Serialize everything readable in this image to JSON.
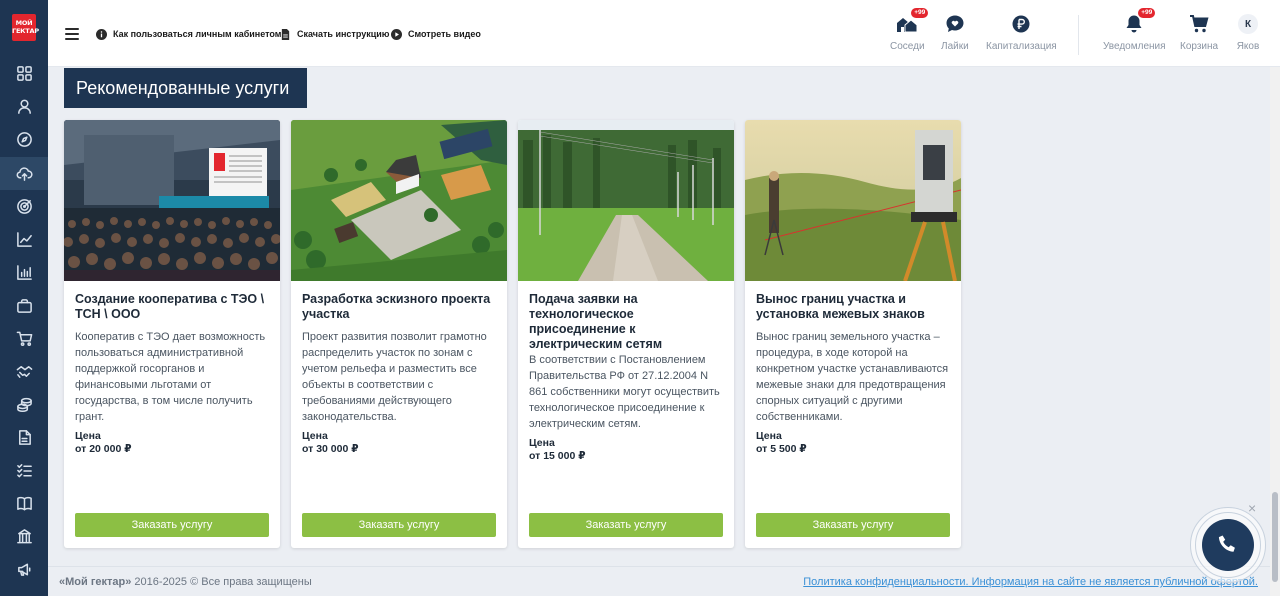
{
  "brand": {
    "logo_line1": "МОЙ",
    "logo_line2": "ГЕКТАР",
    "accent": "#e3262e",
    "sidebar_bg": "#1e3552",
    "button_color": "#8cbf44"
  },
  "sidebar": {
    "items": [
      {
        "icon": "grid-icon"
      },
      {
        "icon": "user-icon"
      },
      {
        "icon": "compass-icon"
      },
      {
        "icon": "cloud-upload-icon",
        "active": true
      },
      {
        "icon": "target-icon"
      },
      {
        "icon": "chart-line-icon"
      },
      {
        "icon": "bar-chart-icon"
      },
      {
        "icon": "briefcase-icon"
      },
      {
        "icon": "cart-icon"
      },
      {
        "icon": "handshake-icon"
      },
      {
        "icon": "coins-icon"
      },
      {
        "icon": "document-icon"
      },
      {
        "icon": "checklist-icon"
      },
      {
        "icon": "book-icon"
      },
      {
        "icon": "building-icon"
      },
      {
        "icon": "megaphone-icon"
      }
    ]
  },
  "header": {
    "links": [
      {
        "label": "Как пользоваться личным кабинетом?",
        "icon": "info-icon"
      },
      {
        "label": "Скачать инструкцию",
        "icon": "file-icon"
      },
      {
        "label": "Смотреть видео",
        "icon": "play-icon"
      }
    ],
    "actions": [
      {
        "label": "Соседи",
        "icon": "neighbors-icon",
        "badge": "+99"
      },
      {
        "label": "Лайки",
        "icon": "like-icon"
      },
      {
        "label": "Капитализация",
        "icon": "ruble-icon"
      },
      {
        "label": "Уведомления",
        "icon": "bell-icon",
        "badge": "+99"
      },
      {
        "label": "Корзина",
        "icon": "cart-icon"
      },
      {
        "label": "Яков",
        "icon": "avatar",
        "initial": "К"
      }
    ]
  },
  "main": {
    "section_title": "Рекомендованные услуги",
    "price_label": "Цена",
    "order_label": "Заказать услугу",
    "cards": [
      {
        "title": "Создание кооператива с ТЭО \\ ТСН \\ ООО",
        "description": "Кооператив с ТЭО дает возможность пользоваться административной поддержкой госорганов и финансовыми льготами от государства, в том числе получить грант.",
        "price": "от 20 000 ₽",
        "image": "conference-hall"
      },
      {
        "title": "Разработка эскизного проекта участка",
        "description": "Проект развития позволит грамотно распределить участок по зонам с учетом рельефа и разместить все объекты в соответствии с требованиями действующего законодательства.",
        "price": "от 30 000 ₽",
        "image": "site-plan-render"
      },
      {
        "title": "Подача заявки на технологическое присоединение к электрическим сетям",
        "description": "В соответствии с Постановлением Правительства РФ от 27.12.2004 N 861 собственники могут осуществить технологическое присоединение к электрическим сетям.",
        "price": "от 15 000 ₽",
        "image": "road-with-power-lines"
      },
      {
        "title": "Вынос границ участка и установка межевых знаков",
        "description": "Вынос границ земельного участка – процедура, в ходе которой на конкретном участке устанавливаются межевые знаки для предотвращения спорных ситуаций с другими собственниками.",
        "price": "от 5 500 ₽",
        "image": "surveyor-field"
      }
    ]
  },
  "footer": {
    "brand": "«Мой гектар»",
    "rights": " 2016-2025 © Все права защищены",
    "privacy_link": "Политика конфиденциальности.",
    "offer_link": " Информация на сайте не является публичной офертой."
  },
  "call_widget": {
    "close": "×",
    "icon": "phone-icon"
  }
}
